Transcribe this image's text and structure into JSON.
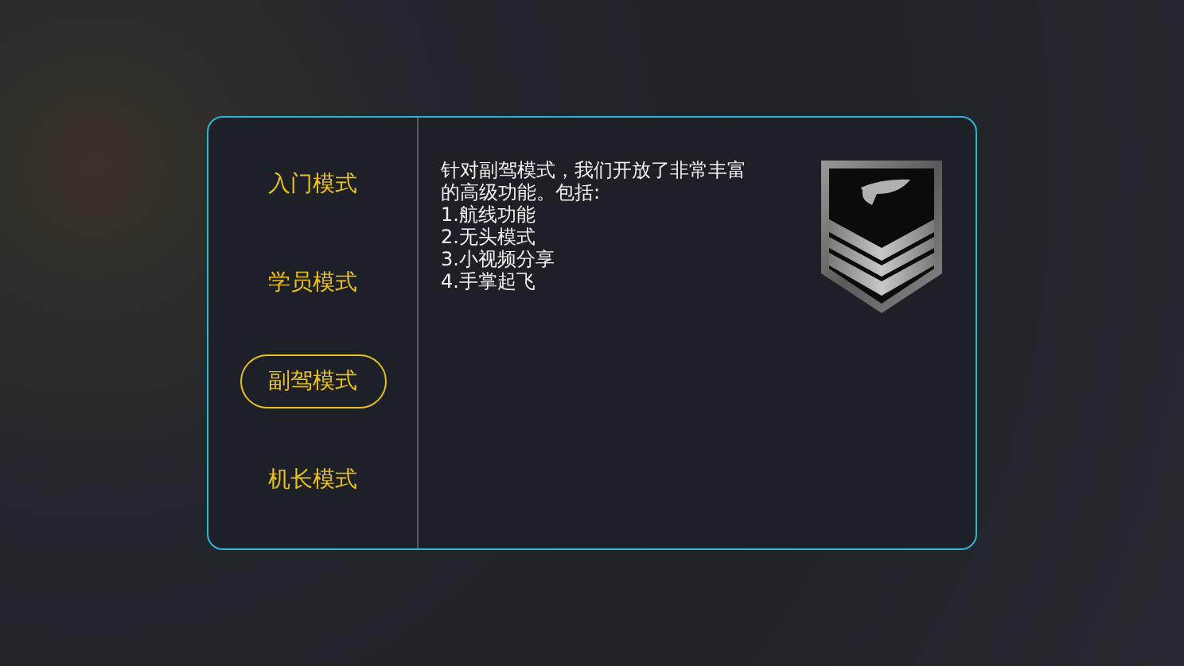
{
  "modes": [
    {
      "label": "入门模式",
      "selected": false
    },
    {
      "label": "学员模式",
      "selected": false
    },
    {
      "label": "副驾模式",
      "selected": true
    },
    {
      "label": "机长模式",
      "selected": false
    }
  ],
  "description": "针对副驾模式，我们开放了非常丰富的高级功能。包括:",
  "features": [
    "1.航线功能",
    "2.无头模式",
    "3.小视频分享",
    "4.手掌起飞"
  ]
}
